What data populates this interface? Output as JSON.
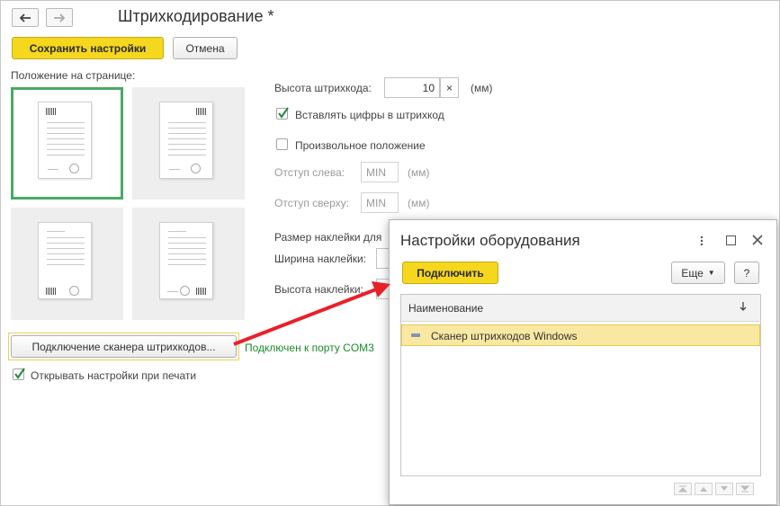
{
  "window": {
    "title": "Штрихкодирование *",
    "back_icon": "arrow-left-icon",
    "forward_icon": "arrow-right-icon"
  },
  "toolbar": {
    "save_label": "Сохранить настройки",
    "cancel_label": "Отмена"
  },
  "position": {
    "label": "Положение на странице:",
    "selected_index": 0
  },
  "barcode": {
    "height_label": "Высота штрихкода:",
    "height_value": "10",
    "height_unit": "(мм)",
    "insert_digits_label": "Вставлять цифры в штрихкод",
    "insert_digits_checked": true,
    "custom_position_label": "Произвольное положение",
    "custom_position_checked": false,
    "left_offset_label": "Отступ слева:",
    "left_offset_value": "MIN",
    "left_offset_unit": "(мм)",
    "top_offset_label": "Отступ сверху:",
    "top_offset_value": "MIN",
    "top_offset_unit": "(мм)",
    "sticker_size_label": "Размер наклейки для",
    "sticker_width_label": "Ширина наклейки:",
    "sticker_height_label": "Высота наклейки:"
  },
  "scanner": {
    "button_label": "Подключение сканера штрихкодов...",
    "status_text": "Подключен к порту COM3",
    "status_color": "#1a8a2a"
  },
  "print_settings": {
    "label": "Открывать настройки при печати",
    "checked": true
  },
  "dialog": {
    "title": "Настройки оборудования",
    "connect_label": "Подключить",
    "more_label": "Еще",
    "help_label": "?",
    "column_header": "Наименование",
    "sort_icon": "sort-down-icon",
    "rows": [
      {
        "name": "Сканер штрихкодов Windows"
      }
    ]
  },
  "colors": {
    "accent_yellow": "#f5d71d",
    "selected_tile_border": "#4aaa62",
    "arrow_red": "#e8202a"
  }
}
